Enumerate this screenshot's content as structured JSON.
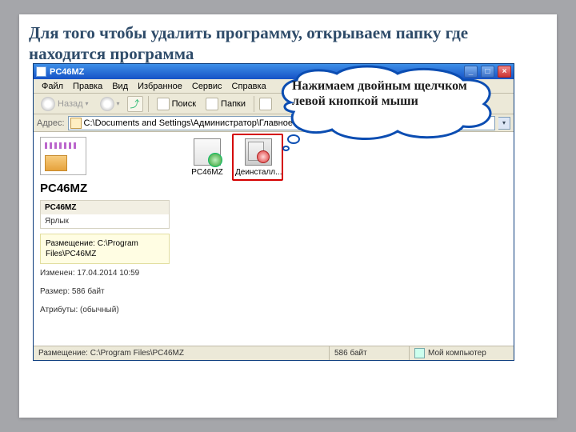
{
  "headline": "Для того чтобы удалить программу, открываем папку где находится программа",
  "bubble_text": "Нажимаем двойным щелчком левой кнопкой мыши",
  "window": {
    "title": "PC46MZ",
    "menu": [
      "Файл",
      "Правка",
      "Вид",
      "Избранное",
      "Сервис",
      "Справка"
    ],
    "toolbar": {
      "back": "Назад",
      "search": "Поиск",
      "folders": "Папки"
    },
    "address": {
      "label": "Адрес:",
      "value": "C:\\Documents and Settings\\Администратор\\Главное меню\\Програм"
    },
    "leftpane": {
      "title": "PC46MZ",
      "block_header": "PC46MZ",
      "block_sub": "Ярлык",
      "placement_label": "Размещение:",
      "placement_value": "C:\\Program Files\\PC46MZ",
      "modified": "Изменен: 17.04.2014 10:59",
      "size": "Размер: 586 байт",
      "attrs": "Атрибуты: (обычный)"
    },
    "files": [
      {
        "name": "PC46MZ",
        "kind": "doc"
      },
      {
        "name": "Деинсталл...",
        "kind": "uninst"
      }
    ],
    "status": {
      "path": "Размещение: C:\\Program Files\\PC46MZ",
      "size": "586 байт",
      "scope": "Мой компьютер"
    }
  }
}
